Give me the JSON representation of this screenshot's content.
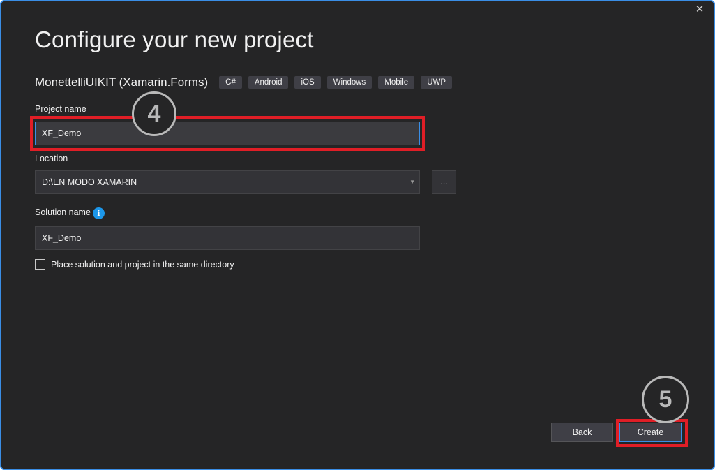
{
  "window": {
    "close_glyph": "✕"
  },
  "page": {
    "title": "Configure your new project"
  },
  "template": {
    "name": "MonettelliUIKIT (Xamarin.Forms)",
    "tags": [
      "C#",
      "Android",
      "iOS",
      "Windows",
      "Mobile",
      "UWP"
    ]
  },
  "project_name": {
    "label": "Project name",
    "value": "XF_Demo"
  },
  "location": {
    "label": "Location",
    "value": "D:\\EN MODO XAMARIN",
    "browse_label": "..."
  },
  "solution_name": {
    "label": "Solution name",
    "value": "XF_Demo",
    "info_glyph": "i"
  },
  "same_directory": {
    "label": "Place solution and project in the same directory",
    "checked": false
  },
  "buttons": {
    "back": "Back",
    "create": "Create"
  },
  "annotations": {
    "step_4": "4",
    "step_5": "5",
    "highlight_color": "#e01e26"
  },
  "colors": {
    "background": "#252526",
    "accent": "#3a8ee6",
    "info": "#1c97ea"
  }
}
